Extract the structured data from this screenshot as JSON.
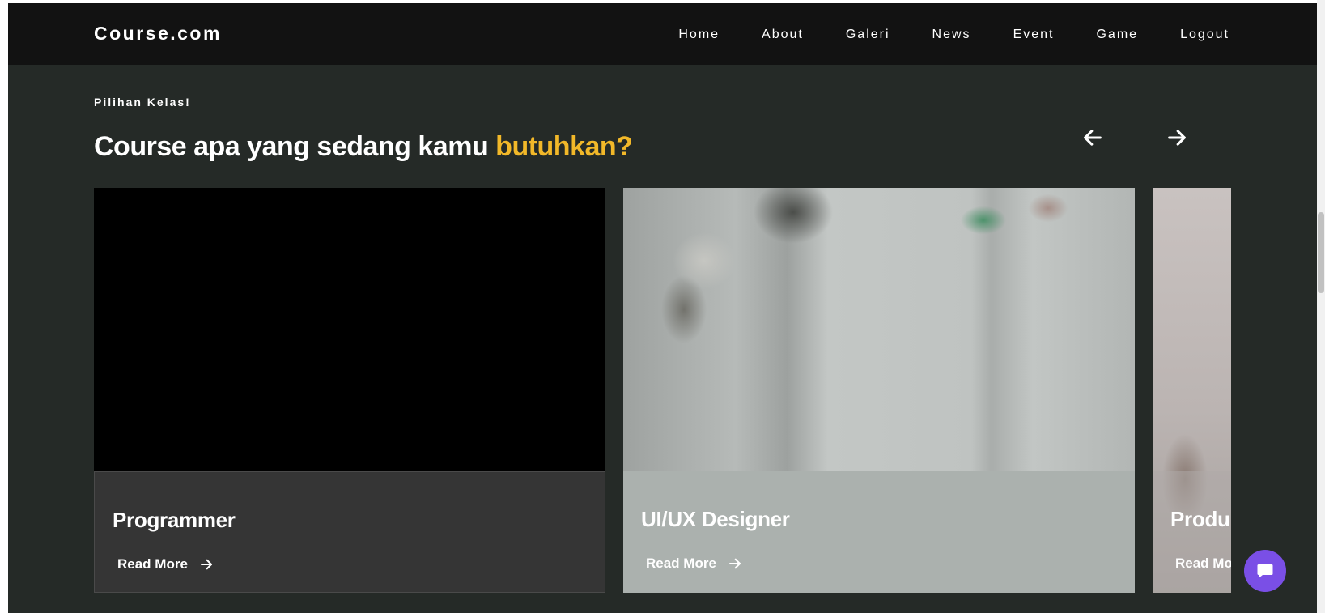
{
  "navbar": {
    "brand": "Course.com",
    "links": [
      "Home",
      "About",
      "Galeri",
      "News",
      "Event",
      "Game",
      "Logout"
    ]
  },
  "section": {
    "eyebrow": "Pilihan Kelas!",
    "headline_main": "Course apa yang sedang kamu ",
    "headline_accent": "butuhkan?"
  },
  "carousel": {
    "prev_icon": "arrow-left-icon",
    "next_icon": "arrow-right-icon"
  },
  "cards": [
    {
      "title": "Programmer",
      "cta": "Read More"
    },
    {
      "title": "UI/UX Designer",
      "cta": "Read More"
    },
    {
      "title": "Produ",
      "cta": "Read Mo"
    }
  ],
  "colors": {
    "navbar_bg": "#121212",
    "page_bg": "#252a27",
    "accent": "#f2b829",
    "chat_button": "#7a4fe6"
  },
  "chat": {
    "icon": "chat-bubble-icon"
  }
}
